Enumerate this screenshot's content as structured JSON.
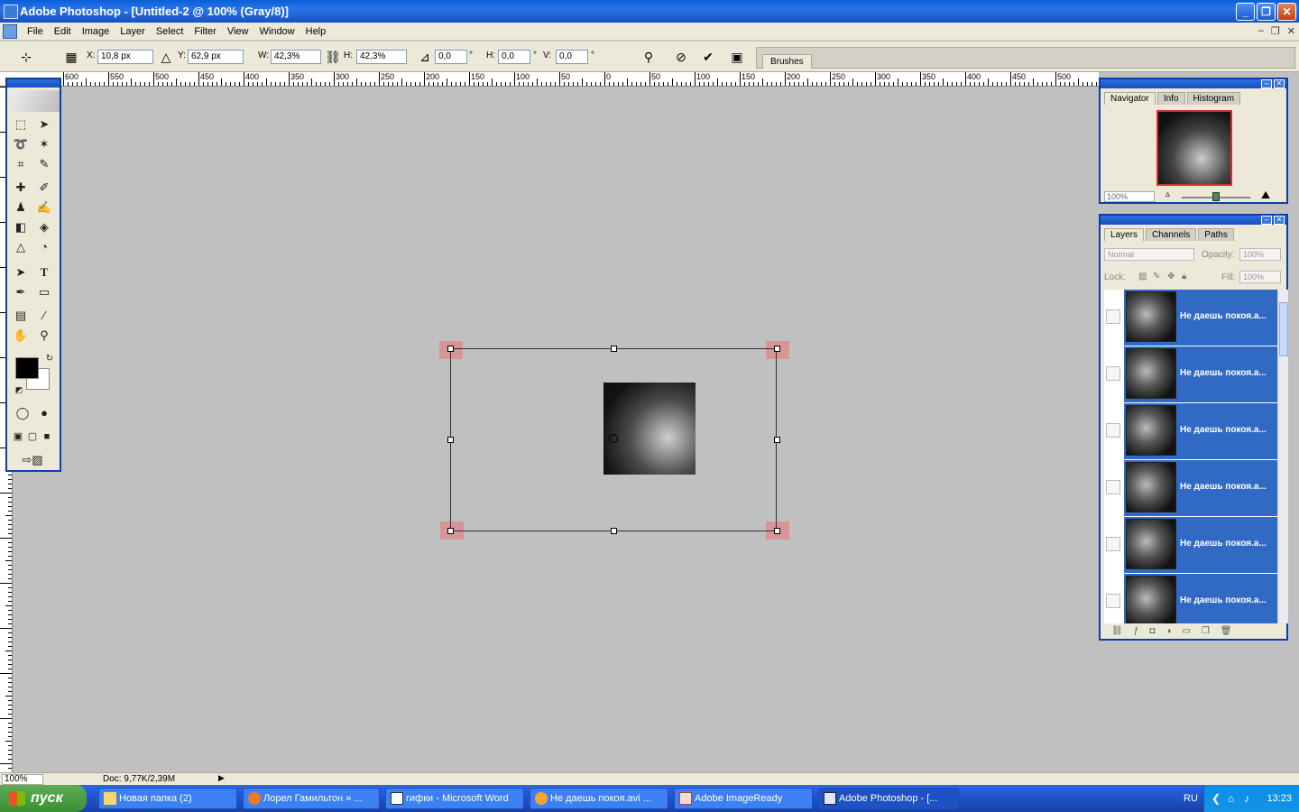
{
  "window": {
    "title": "Adobe Photoshop - [Untitled-2 @ 100% (Gray/8)]"
  },
  "menu": [
    "File",
    "Edit",
    "Image",
    "Layer",
    "Select",
    "Filter",
    "View",
    "Window",
    "Help"
  ],
  "doc_controls": {
    "minimize": "–",
    "restore": "❐",
    "close": "✕"
  },
  "options": {
    "x_label": "X:",
    "x_value": "10,8 px",
    "y_label": "Y:",
    "y_value": "62,9 px",
    "w_label": "W:",
    "w_value": "42,3%",
    "h_label": "H:",
    "h_value": "42,3%",
    "rot_value": "0,0",
    "rot_unit": "°",
    "hskew_label": "H:",
    "hskew_value": "0,0",
    "hskew_unit": "°",
    "vskew_label": "V:",
    "vskew_value": "0,0",
    "vskew_unit": "°",
    "brushes_tab": "Brushes"
  },
  "ruler_labels": [
    "600",
    "550",
    "500",
    "450",
    "400",
    "350",
    "300",
    "250",
    "200",
    "150",
    "100",
    "50",
    "0",
    "50",
    "100",
    "150",
    "200",
    "250",
    "300",
    "350",
    "400",
    "450",
    "500"
  ],
  "navigator": {
    "tabs": [
      "Navigator",
      "Info",
      "Histogram"
    ],
    "zoom": "100%"
  },
  "layers": {
    "tabs": [
      "Layers",
      "Channels",
      "Paths"
    ],
    "blend_mode": "Normal",
    "opacity_label": "Opacity:",
    "opacity_value": "100%",
    "lock_label": "Lock:",
    "fill_label": "Fill:",
    "fill_value": "100%",
    "items": [
      {
        "name": "Не даешь покоя.a..."
      },
      {
        "name": "Не даешь покоя.a..."
      },
      {
        "name": "Не даешь покоя.a..."
      },
      {
        "name": "Не даешь покоя.a..."
      },
      {
        "name": "Не даешь покоя.a..."
      },
      {
        "name": "Не даешь покоя.a..."
      }
    ]
  },
  "status": {
    "zoom": "100%",
    "doc": "Doc: 9,77K/2,39M"
  },
  "taskbar": {
    "start": "пуск",
    "tasks": [
      {
        "label": "Новая папка (2)"
      },
      {
        "label": "Лорел Гамильтон » ..."
      },
      {
        "label": "гифки - Microsoft Word"
      },
      {
        "label": "Не даешь покоя.avi ..."
      },
      {
        "label": "Adobe ImageReady"
      },
      {
        "label": "Adobe Photoshop - [..."
      }
    ],
    "lang": "RU",
    "clock": "13:23"
  }
}
